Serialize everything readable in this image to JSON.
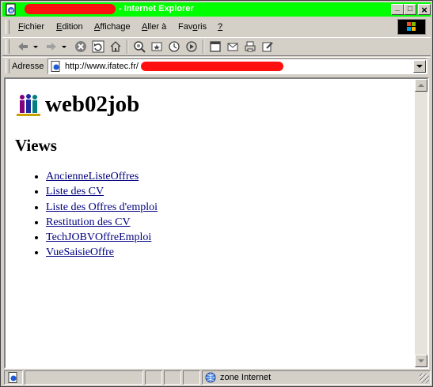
{
  "window": {
    "title_suffix": "- Internet Explorer",
    "controls": {
      "minimize": "_",
      "maximize": "□",
      "close": "×"
    },
    "colors": {
      "titlebar": "#00ff00",
      "redaction": "#ff1010"
    }
  },
  "menu": {
    "items": [
      {
        "label": "Fichier",
        "accel": "F",
        "rest": "ichier"
      },
      {
        "label": "Edition",
        "accel": "E",
        "rest": "dition"
      },
      {
        "label": "Affichage",
        "accel": "A",
        "rest": "ffichage"
      },
      {
        "label": "Aller à",
        "accel": "A",
        "rest": "ller à"
      },
      {
        "label": "Favoris",
        "accel": "o",
        "pre": "Fav",
        "rest": "ris"
      },
      {
        "label": "?",
        "accel": "?",
        "rest": ""
      }
    ]
  },
  "toolbar": {
    "icons": [
      "back-icon",
      "forward-icon",
      "stop-icon",
      "refresh-icon",
      "home-icon",
      "search-icon",
      "favorites-icon",
      "history-icon",
      "media-icon",
      "fullscreen-icon",
      "mail-icon",
      "print-icon",
      "edit-icon"
    ]
  },
  "address": {
    "label": "Adresse",
    "url_visible": "http://www.ifatec.fr/"
  },
  "page": {
    "heading": "web02job",
    "section_title": "Views",
    "links": [
      "AncienneListeOffres",
      "Liste des CV",
      "Liste des Offres d'emploi",
      "Restitution des CV",
      "TechJOBVOffreEmploi",
      "VueSaisieOffre"
    ],
    "link_color": "#000080"
  },
  "status": {
    "zone": "zone Internet"
  }
}
